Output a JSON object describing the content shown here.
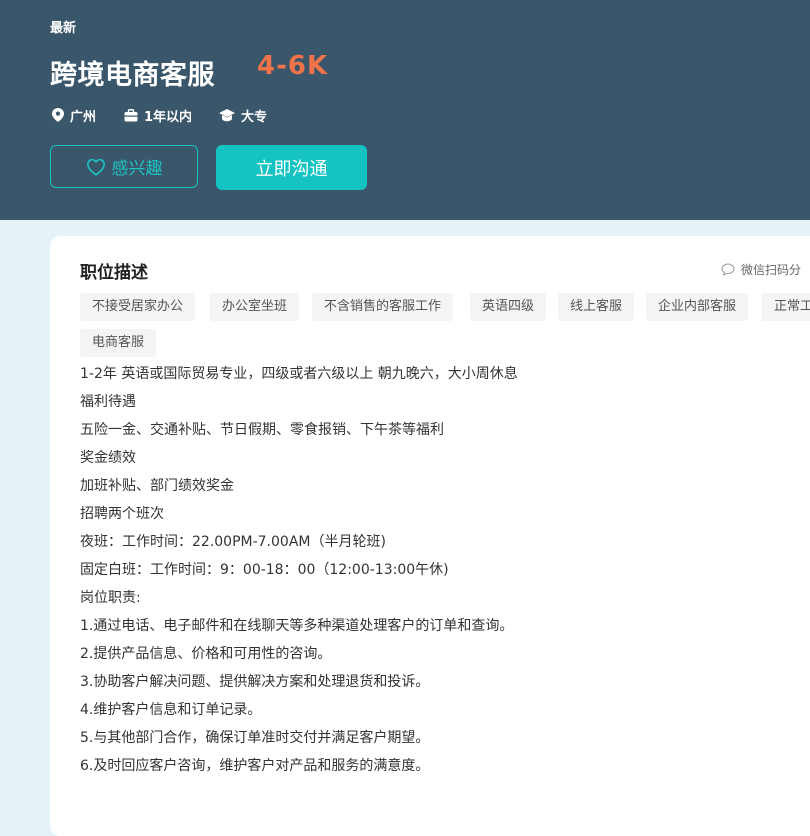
{
  "job": {
    "badge": "最新",
    "title": "跨境电商客服",
    "salary": "4-6K",
    "location": "广州",
    "experience": "1年以内",
    "education": "大专"
  },
  "actions": {
    "interest_label": "感兴趣",
    "chat_label": "立即沟通"
  },
  "section": {
    "title": "职位描述",
    "share_label": "微信扫码分"
  },
  "tags": [
    "不接受居家办公",
    "办公室坐班",
    "不含销售的客服工作",
    "英语四级",
    "线上客服",
    "企业内部客服",
    "正常工",
    "电商客服"
  ],
  "description": [
    "1-2年  英语或国际贸易专业，四级或者六级以上  朝九晚六，大小周休息",
    "福利待遇",
    "五险一金、交通补贴、节日假期、零食报销、下午茶等福利",
    "奖金绩效",
    "加班补贴、部门绩效奖金",
    "招聘两个班次",
    "夜班：工作时间：22.00PM-7.00AM（半月轮班)",
    "固定白班：工作时间：9：00-18：00（12:00-13:00午休)",
    "岗位职责:",
    "1.通过电话、电子邮件和在线聊天等多种渠道处理客户的订单和查询。",
    "2.提供产品信息、价格和可用性的咨询。",
    "3.协助客户解决问题、提供解决方案和处理退货和投诉。",
    "4.维护客户信息和订单记录。",
    "5.与其他部门合作，确保订单准时交付并满足客户期望。",
    "6.及时回应客户咨询，维护客户对产品和服务的满意度。"
  ],
  "colors": {
    "header_bg": "#3a566a",
    "salary": "#f2734a",
    "accent": "#14c3c2"
  }
}
